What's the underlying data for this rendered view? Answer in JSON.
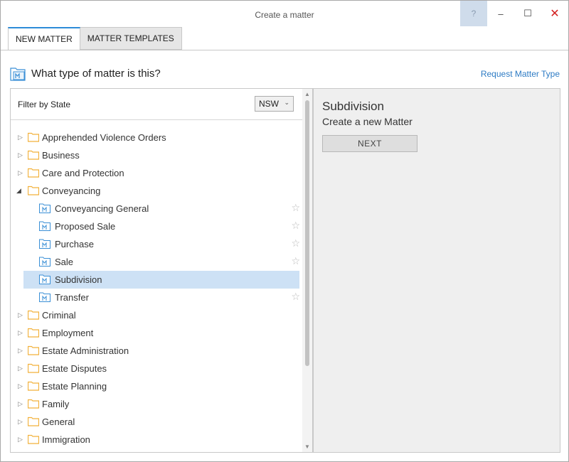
{
  "window": {
    "title": "Create a matter"
  },
  "titlebar": {
    "help": "?",
    "minimize": "–",
    "maximize": "☐",
    "close": "✕"
  },
  "tabs": [
    {
      "label": "NEW MATTER",
      "active": true
    },
    {
      "label": "MATTER TEMPLATES",
      "active": false
    }
  ],
  "heading": {
    "text": "What type of matter is this?",
    "icon": "matter-icon"
  },
  "request_link": "Request Matter Type",
  "filter": {
    "label": "Filter by State",
    "selected": "NSW"
  },
  "tree": {
    "Apprehended Violence Orders": "Apprehended Violence Orders",
    "Business": "Business",
    "Care and Protection": "Care and Protection",
    "Conveyancing": "Conveyancing",
    "Conveyancing General": "Conveyancing General",
    "Proposed Sale": "Proposed Sale",
    "Purchase": "Purchase",
    "Sale": "Sale",
    "Subdivision": "Subdivision",
    "Transfer": "Transfer",
    "Criminal": "Criminal",
    "Employment": "Employment",
    "Estate Administration": "Estate Administration",
    "Estate Disputes": "Estate Disputes",
    "Estate Planning": "Estate Planning",
    "Family": "Family",
    "General": "General",
    "Immigration": "Immigration"
  },
  "details": {
    "title": "Subdivision",
    "subtitle": "Create a new Matter",
    "next_label": "NEXT"
  },
  "colors": {
    "accent": "#2d8cd8",
    "link": "#2d7bc4",
    "selected_row": "#cde1f5",
    "folder": "#f2b13a",
    "close": "#d32020"
  }
}
